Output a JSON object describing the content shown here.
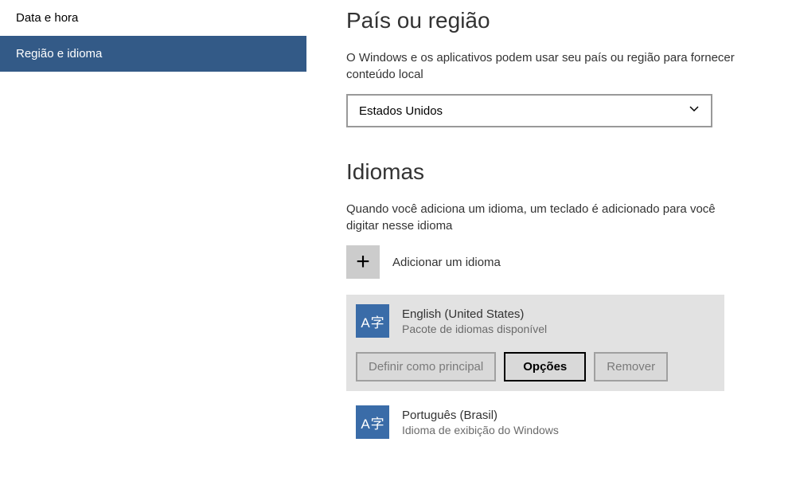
{
  "sidebar": {
    "items": [
      {
        "label": "Data e hora",
        "selected": false
      },
      {
        "label": "Região e idioma",
        "selected": true
      }
    ]
  },
  "region": {
    "title": "País ou região",
    "description": "O Windows e os aplicativos podem usar seu país ou região para fornecer conteúdo local",
    "selected": "Estados Unidos"
  },
  "languages": {
    "title": "Idiomas",
    "description": "Quando você adiciona um idioma, um teclado é adicionado para você digitar nesse idioma",
    "add_label": "Adicionar um idioma",
    "plus_glyph": "+",
    "items": [
      {
        "name": "English (United States)",
        "subtitle": "Pacote de idiomas disponível",
        "expanded": true,
        "actions": {
          "set_default": "Definir como principal",
          "options": "Opções",
          "remove": "Remover"
        }
      },
      {
        "name": "Português (Brasil)",
        "subtitle": "Idioma de exibição do Windows",
        "expanded": false
      }
    ],
    "icon_glyph_a": "A",
    "icon_glyph_cjk": "字"
  }
}
